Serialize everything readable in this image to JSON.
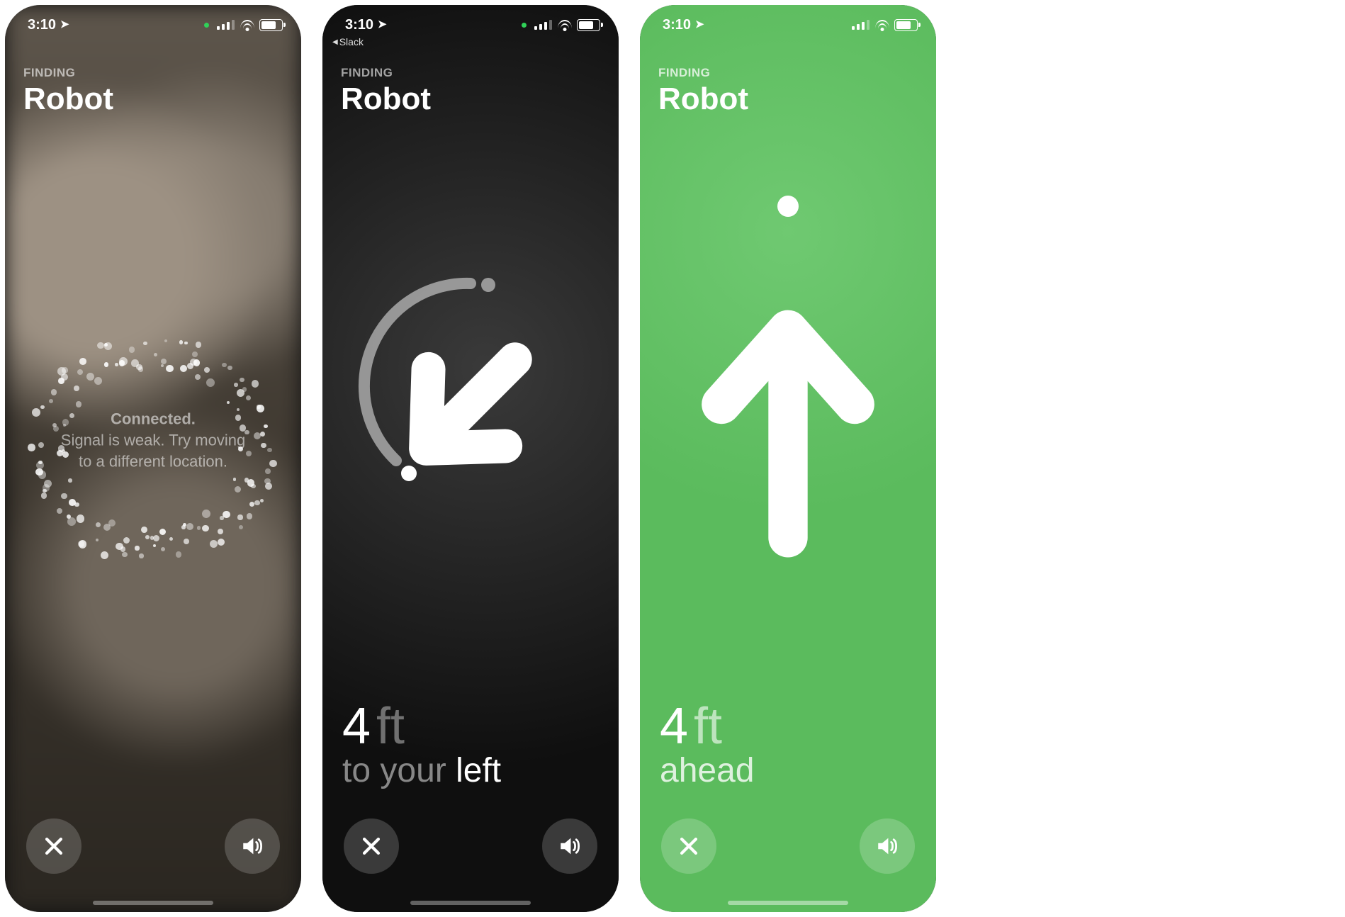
{
  "status": {
    "time": "3:10"
  },
  "header": {
    "eyebrow": "FINDING",
    "title": "Robot"
  },
  "screen1": {
    "msg_title": "Connected.",
    "msg_line2": "Signal is weak. Try moving",
    "msg_line3": "to a different location."
  },
  "screen2": {
    "back_app": "Slack",
    "distance_value": "4",
    "distance_unit": "ft",
    "dir_prefix": "to your",
    "dir_word": "left"
  },
  "screen3": {
    "distance_value": "4",
    "distance_unit": "ft",
    "dir_word": "ahead"
  }
}
